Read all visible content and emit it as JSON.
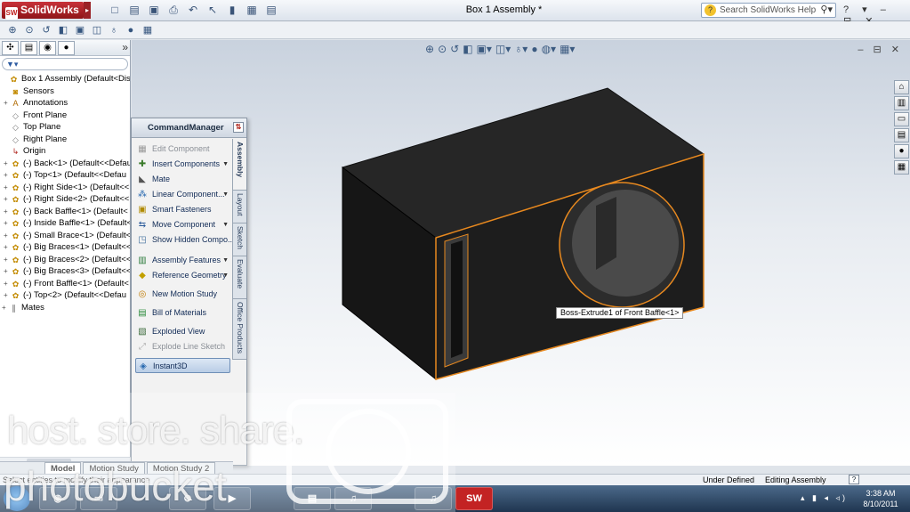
{
  "app": {
    "logo_text": "SolidWorks",
    "window_title": "Box 1 Assembly *",
    "search_placeholder": "Search SolidWorks Help",
    "help_controls": "? ▾ – ⊟ ✕"
  },
  "feature_manager": {
    "more_label": "»",
    "filter_label": "▼▾",
    "tree": [
      {
        "label": "Box 1 Assembly  (Default<Display",
        "icon": "assembly-icon",
        "indent": 0
      },
      {
        "label": "Sensors",
        "icon": "sensors-icon",
        "indent": 1
      },
      {
        "label": "Annotations",
        "icon": "annotations-icon",
        "indent": 1,
        "expander": "+"
      },
      {
        "label": "Front Plane",
        "icon": "plane-icon",
        "indent": 1
      },
      {
        "label": "Top Plane",
        "icon": "plane-icon",
        "indent": 1
      },
      {
        "label": "Right Plane",
        "icon": "plane-icon",
        "indent": 1
      },
      {
        "label": "Origin",
        "icon": "origin-icon",
        "indent": 1
      },
      {
        "label": "(-) Back<1> (Default<<Defau",
        "icon": "part-icon",
        "indent": 1,
        "expander": "+"
      },
      {
        "label": "(-) Top<1> (Default<<Defau",
        "icon": "part-icon",
        "indent": 1,
        "expander": "+"
      },
      {
        "label": "(-) Right Side<1> (Default<<",
        "icon": "part-icon",
        "indent": 1,
        "expander": "+"
      },
      {
        "label": "(-) Right Side<2> (Default<<",
        "icon": "part-icon",
        "indent": 1,
        "expander": "+"
      },
      {
        "label": "(-) Back Baffle<1> (Default<",
        "icon": "part-icon",
        "indent": 1,
        "expander": "+"
      },
      {
        "label": "(-) Inside Baffle<1> (Default<",
        "icon": "part-icon",
        "indent": 1,
        "expander": "+"
      },
      {
        "label": "(-) Small Brace<1> (Default<",
        "icon": "part-icon",
        "indent": 1,
        "expander": "+"
      },
      {
        "label": "(-) Big Braces<1> (Default<<",
        "icon": "part-icon",
        "indent": 1,
        "expander": "+"
      },
      {
        "label": "(-) Big Braces<2> (Default<<",
        "icon": "part-icon",
        "indent": 1,
        "expander": "+"
      },
      {
        "label": "(-) Big Braces<3> (Default<<",
        "icon": "part-icon",
        "indent": 1,
        "expander": "+"
      },
      {
        "label": "(-) Front Baffle<1> (Default<",
        "icon": "part-icon",
        "indent": 1,
        "expander": "+"
      },
      {
        "label": "(-) Top<2> (Default<<Defau",
        "icon": "part-icon",
        "indent": 1,
        "expander": "+"
      },
      {
        "label": "Mates",
        "icon": "mates-icon",
        "indent": 0,
        "expander": "+"
      }
    ]
  },
  "command_manager": {
    "title": "CommandManager",
    "items": [
      {
        "label": "Edit Component",
        "icon": "edit-component-icon",
        "disabled": true
      },
      {
        "label": "Insert Components",
        "icon": "insert-components-icon",
        "dropdown": true
      },
      {
        "label": "Mate",
        "icon": "mate-icon"
      },
      {
        "label": "Linear Component...",
        "icon": "linear-pattern-icon",
        "dropdown": true
      },
      {
        "label": "Smart Fasteners",
        "icon": "smart-fasteners-icon"
      },
      {
        "label": "Move Component",
        "icon": "move-component-icon",
        "dropdown": true
      },
      {
        "label": "Show Hidden Compo...",
        "icon": "show-hidden-icon"
      },
      {
        "label": "Assembly Features",
        "icon": "assembly-features-icon",
        "dropdown": true
      },
      {
        "label": "Reference Geometry",
        "icon": "reference-geometry-icon",
        "dropdown": true
      },
      {
        "label": "New Motion Study",
        "icon": "motion-study-icon"
      },
      {
        "label": "Bill of Materials",
        "icon": "bom-icon"
      },
      {
        "label": "Exploded View",
        "icon": "exploded-view-icon"
      },
      {
        "label": "Explode Line Sketch",
        "icon": "explode-line-icon",
        "disabled": true
      },
      {
        "label": "Instant3D",
        "icon": "instant3d-icon",
        "active": true
      }
    ],
    "tabs": [
      "Assembly",
      "Layout",
      "Sketch",
      "Evaluate",
      "Office Products"
    ]
  },
  "viewport": {
    "tooltip": "Boss-Extrude1 of Front Baffle<1>",
    "controls": "– ⊟ ✕"
  },
  "bottom_tabs": [
    "Model",
    "Motion Study",
    "Motion Study 2"
  ],
  "statusbar": {
    "message": "Select entities to modify their appearance",
    "under_defined": "Under Defined",
    "editing": "Editing Assembly",
    "help_label": "?"
  },
  "taskbar": {
    "time": "3:38 AM",
    "date": "8/10/2011",
    "solidworks_label": "SW",
    "tray": "▴ ▮ ◂ ◃)"
  },
  "watermark": {
    "tagline": "host. store. share.",
    "brand": "photobucket"
  },
  "colors": {
    "highlight": "#e8891f",
    "box_face": "#1f1f1f",
    "app_red": "#c0201f"
  }
}
